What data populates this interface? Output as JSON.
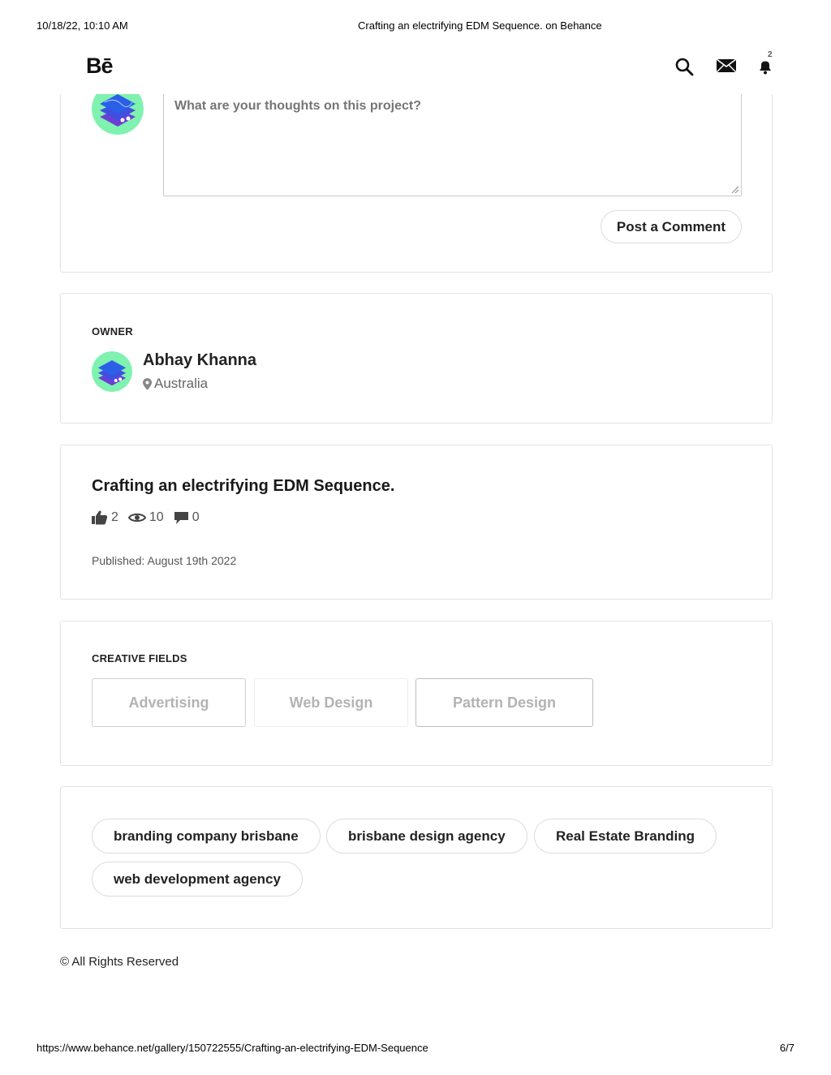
{
  "print_header": {
    "datetime": "10/18/22, 10:10 AM",
    "page_title": "Crafting an electrifying EDM Sequence. on Behance"
  },
  "topbar": {
    "logo": "Bē",
    "icons": [
      "search-icon",
      "mail-icon",
      "bell-icon"
    ],
    "notification_count": "2"
  },
  "comment": {
    "placeholder": "What are your thoughts on this project?",
    "post_button": "Post a Comment"
  },
  "owner": {
    "label": "OWNER",
    "name": "Abhay Khanna",
    "location": "Australia"
  },
  "project": {
    "title": "Crafting an electrifying EDM Sequence.",
    "appreciations": "2",
    "views": "10",
    "comments": "0",
    "published": "Published: August 19th 2022"
  },
  "creative_fields": {
    "label": "CREATIVE FIELDS",
    "items": [
      "Advertising",
      "Web Design",
      "Pattern Design"
    ]
  },
  "tags": [
    "branding company brisbane",
    "brisbane design agency",
    "Real Estate Branding",
    "web development agency"
  ],
  "footer": {
    "copyright": "© All Rights Reserved"
  },
  "print_footer": {
    "url": "https://www.behance.net/gallery/150722555/Crafting-an-electrifying-EDM-Sequence",
    "page": "6/7"
  },
  "colors": {
    "avatar_bg": "#7ff2b0",
    "avatar_stack_blue": "#2b5fe8",
    "avatar_stack_purple": "#6b3fd6"
  }
}
